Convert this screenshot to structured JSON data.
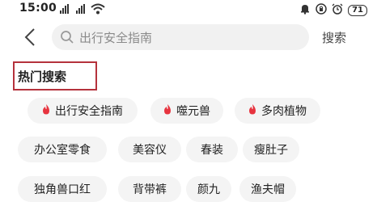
{
  "status_bar": {
    "time": "15:00",
    "battery": "71"
  },
  "search": {
    "placeholder": "出行安全指南",
    "button_label": "搜索"
  },
  "hot_section": {
    "title": "热门搜索"
  },
  "tags_row1": [
    {
      "label": "出行安全指南",
      "hot": true
    },
    {
      "label": "噬元兽",
      "hot": true
    },
    {
      "label": "多肉植物",
      "hot": true
    }
  ],
  "tags_row2": [
    {
      "label": "办公室零食"
    },
    {
      "label": "美容仪"
    },
    {
      "label": "春装"
    },
    {
      "label": "瘦肚子"
    }
  ],
  "tags_row3": [
    {
      "label": "独角兽口红"
    },
    {
      "label": "背带裤"
    },
    {
      "label": "颜九"
    },
    {
      "label": "渔夫帽"
    }
  ],
  "colors": {
    "accent": "#e7343f",
    "highlight_box": "#b5323c"
  }
}
